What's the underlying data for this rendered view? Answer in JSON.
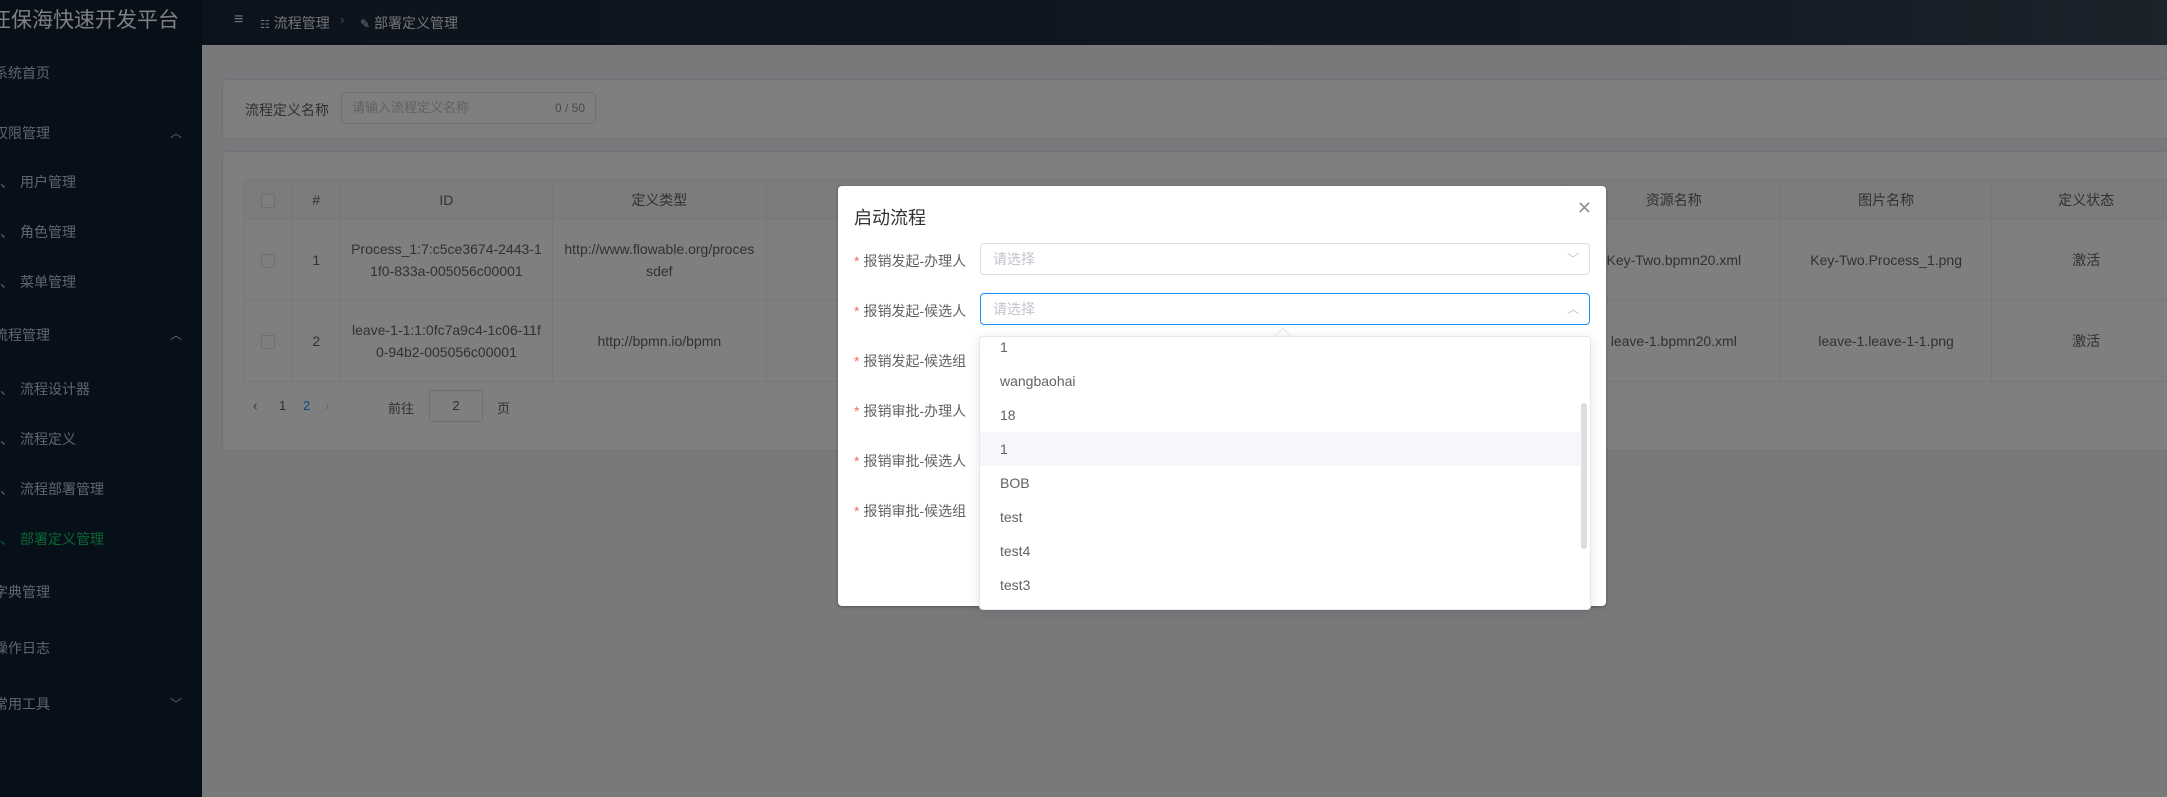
{
  "app": {
    "title": "汪保海快速开发平台"
  },
  "sidebar": {
    "items": [
      {
        "label": "系统首页"
      },
      {
        "label": "权限管理",
        "arrow": "chevron-up"
      },
      {
        "label": "用户管理"
      },
      {
        "label": "角色管理"
      },
      {
        "label": "菜单管理"
      },
      {
        "label": "流程管理",
        "arrow": "chevron-up"
      },
      {
        "label": "流程设计器"
      },
      {
        "label": "流程定义"
      },
      {
        "label": "流程部署管理"
      },
      {
        "label": "部署定义管理"
      },
      {
        "label": "字典管理"
      },
      {
        "label": "操作日志"
      },
      {
        "label": "常用工具",
        "arrow": "chevron-down"
      }
    ],
    "active_color": "#13ce66",
    "background": "#0f1e33"
  },
  "header": {
    "breadcrumb": [
      {
        "label": "流程管理"
      },
      {
        "label": "部署定义管理"
      }
    ]
  },
  "search": {
    "label": "流程定义名称",
    "placeholder": "请输入流程定义名称",
    "count": "0 / 50"
  },
  "table": {
    "columns": [
      "#",
      "ID",
      "定义类型",
      "资源名称",
      "图片名称",
      "定义状态"
    ],
    "rows": [
      {
        "index": "1",
        "id": "Process_1:7:c5ce3674-2443-11f0-833a-005056c00001",
        "type": "http://www.flowable.org/processdef",
        "resource": "Key-Two.bpmn20.xml",
        "image": "Key-Two.Process_1.png",
        "status": "激活"
      },
      {
        "index": "2",
        "id": "leave-1-1:1:0fc7a9c4-1c06-11f0-94b2-005056c00001",
        "type": "http://bpmn.io/bpmn",
        "resource": "leave-1.bpmn20.xml",
        "image": "leave-1.leave-1-1.png",
        "status": "激活"
      }
    ]
  },
  "pagination": {
    "pages": [
      "1",
      "2"
    ],
    "current": "2",
    "goto_prefix": "前往",
    "goto_value": "2",
    "goto_suffix": "页"
  },
  "dialog": {
    "title": "启动流程",
    "fields": [
      {
        "label": "报销发起-办理人",
        "placeholder": "请选择"
      },
      {
        "label": "报销发起-候选人",
        "placeholder": "请选择"
      },
      {
        "label": "报销发起-候选组"
      },
      {
        "label": "报销审批-办理人"
      },
      {
        "label": "报销审批-候选人"
      },
      {
        "label": "报销审批-候选组"
      }
    ]
  },
  "dropdown": {
    "options": [
      "1",
      "wangbaohai",
      "18",
      "1",
      "BOB",
      "test",
      "test4",
      "test3"
    ],
    "hover_index": 3
  },
  "colors": {
    "primary": "#1890ff",
    "required": "#f56c6c"
  }
}
